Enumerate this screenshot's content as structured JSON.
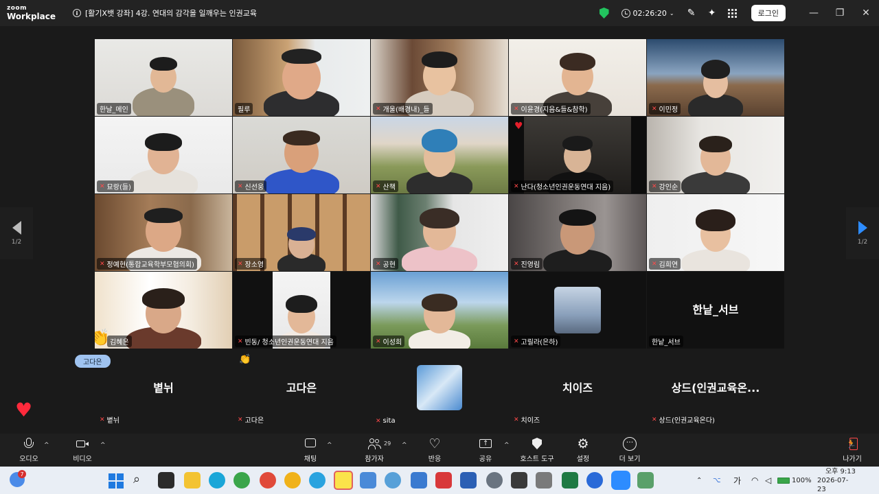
{
  "app": {
    "logo_line1": "zoom",
    "logo_line2": "Workplace",
    "meeting_title": "[활기X뱃 강좌] 4강. 연대의 감각을 일깨우는 인권교육",
    "timer": "02:26:20",
    "login_label": "로그인"
  },
  "colors": {
    "accent_blue": "#2d8cff",
    "security_green": "#22c35e",
    "mic_muted_red": "#ff4a4a",
    "speaking_outline": "#3ad16a"
  },
  "gallery": {
    "page_left": "1/2",
    "page_right": "1/2",
    "tiles": [
      {
        "name": "한날_메인",
        "muted": false
      },
      {
        "name": "필루",
        "muted": false
      },
      {
        "name": "개울(배경내)_들",
        "muted": true
      },
      {
        "name": "이윤경(지음&들&참학)",
        "muted": true
      },
      {
        "name": "이민정",
        "muted": true
      },
      {
        "name": "묘랑(들)",
        "muted": true
      },
      {
        "name": "신선웅",
        "muted": true
      },
      {
        "name": "산책",
        "muted": true
      },
      {
        "name": "난다(청소년인권운동연대 지음)",
        "muted": true
      },
      {
        "name": "강인순",
        "muted": true
      },
      {
        "name": "정예현(통합교육학부모협의회)",
        "muted": true
      },
      {
        "name": "장소영",
        "muted": true
      },
      {
        "name": "공현",
        "muted": true
      },
      {
        "name": "진영림",
        "muted": true
      },
      {
        "name": "김희연",
        "muted": true
      },
      {
        "name": "김혜은",
        "muted": false
      },
      {
        "name": "빈동/ 청소년인권운동연대 지음",
        "muted": true
      },
      {
        "name": "이성희",
        "muted": true
      },
      {
        "name": "고릴라(은하)",
        "muted": true
      },
      {
        "name": "한낱_서브",
        "muted": false,
        "display_name": "한낱_서브"
      }
    ]
  },
  "strip": {
    "pill_label": "고다은",
    "tiles": [
      {
        "display_name": "볕뉘",
        "name": "볕뉘"
      },
      {
        "display_name": "고다은",
        "name": "고다은"
      },
      {
        "display_name": "",
        "name": "sita"
      },
      {
        "display_name": "치이즈",
        "name": "치이즈"
      },
      {
        "display_name": "상드(인권교육온...",
        "name": "상드(인권교육온다)"
      }
    ]
  },
  "toolbar": {
    "audio": "오디오",
    "video": "비디오",
    "chat": "채팅",
    "participants": "참가자",
    "participants_count": "29",
    "reactions": "반응",
    "share": "공유",
    "host_tools": "호스트 도구",
    "settings": "설정",
    "more": "더 보기",
    "leave": "나가기"
  },
  "taskbar": {
    "notification_count": "7",
    "battery": "100%",
    "ime": "가",
    "time": "오후 9:13",
    "date": "2026-07-23"
  }
}
